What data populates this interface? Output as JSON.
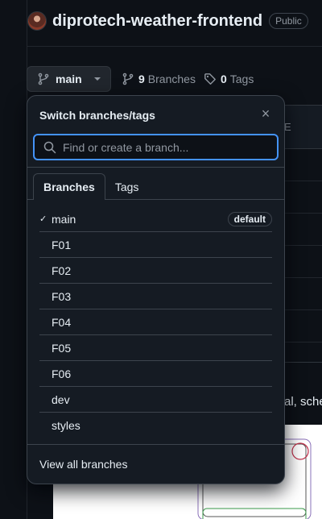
{
  "repo": {
    "name": "diprotech-weather-frontend",
    "visibility": "Public"
  },
  "toolbar": {
    "branch_label": "main",
    "branches_count": "9",
    "branches_label": "Branches",
    "tags_count": "0",
    "tags_label": "Tags"
  },
  "background": {
    "partial_header": "E",
    "readme_fragment": "al, sche"
  },
  "dropdown": {
    "title": "Switch branches/tags",
    "search_placeholder": "Find or create a branch...",
    "tabs": [
      {
        "label": "Branches",
        "active": true
      },
      {
        "label": "Tags",
        "active": false
      }
    ],
    "branches": [
      {
        "name": "main",
        "selected": true,
        "badge": "default"
      },
      {
        "name": "F01"
      },
      {
        "name": "F02"
      },
      {
        "name": "F03"
      },
      {
        "name": "F04"
      },
      {
        "name": "F05"
      },
      {
        "name": "F06"
      },
      {
        "name": "dev"
      },
      {
        "name": "styles"
      }
    ],
    "view_all": "View all branches"
  },
  "colors": {
    "background": "#0d1117",
    "overlay": "#151b23",
    "border": "#3d444d",
    "focus": "#4493f8",
    "muted": "#9198a1"
  }
}
